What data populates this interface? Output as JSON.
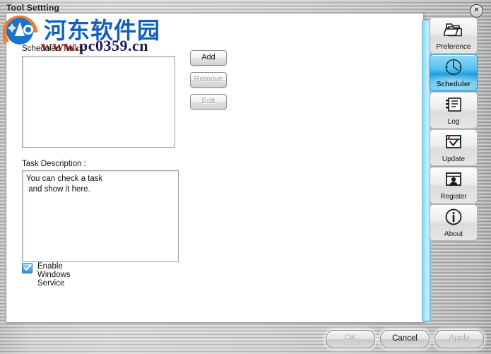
{
  "window": {
    "title": "Tool Settting",
    "close_label": "×"
  },
  "watermark": {
    "chinese_text": "河东软件园",
    "url_prefix": "www.",
    "url_domain": "pc0359.cn"
  },
  "main": {
    "scheduled_tasks_label": "Scheduled Tasks:",
    "task_list_items": [],
    "task_description_label": "Task Description :",
    "task_description_text": "You can check a task\n and show it here.",
    "buttons": [
      {
        "label": "Add",
        "enabled": true
      },
      {
        "label": "Remove",
        "enabled": false
      },
      {
        "label": "Edit",
        "enabled": false
      }
    ],
    "checkbox": {
      "label": "Enable Windows Service",
      "checked": true
    }
  },
  "sidebar": {
    "items": [
      {
        "label": "Preference",
        "icon": "folder-stack-icon",
        "active": false
      },
      {
        "label": "Scheduler",
        "icon": "clock-icon",
        "active": true
      },
      {
        "label": "Log",
        "icon": "notebook-icon",
        "active": false
      },
      {
        "label": "Update",
        "icon": "window-check-icon",
        "active": false
      },
      {
        "label": "Register",
        "icon": "user-card-icon",
        "active": false
      },
      {
        "label": "About",
        "icon": "info-icon",
        "active": false
      }
    ]
  },
  "footer": {
    "ok_label": "OK",
    "cancel_label": "Cancel",
    "apply_label": "Apply",
    "ok_enabled": false,
    "cancel_enabled": true,
    "apply_enabled": false
  },
  "colors": {
    "accent_blue": "#1e9fe0",
    "strip_cyan": "#a8e4f7",
    "panel_white": "#ffffff",
    "chrome_silver": "#c6c6c6",
    "watermark_blue": "#1060c0",
    "watermark_red": "#c02020"
  }
}
